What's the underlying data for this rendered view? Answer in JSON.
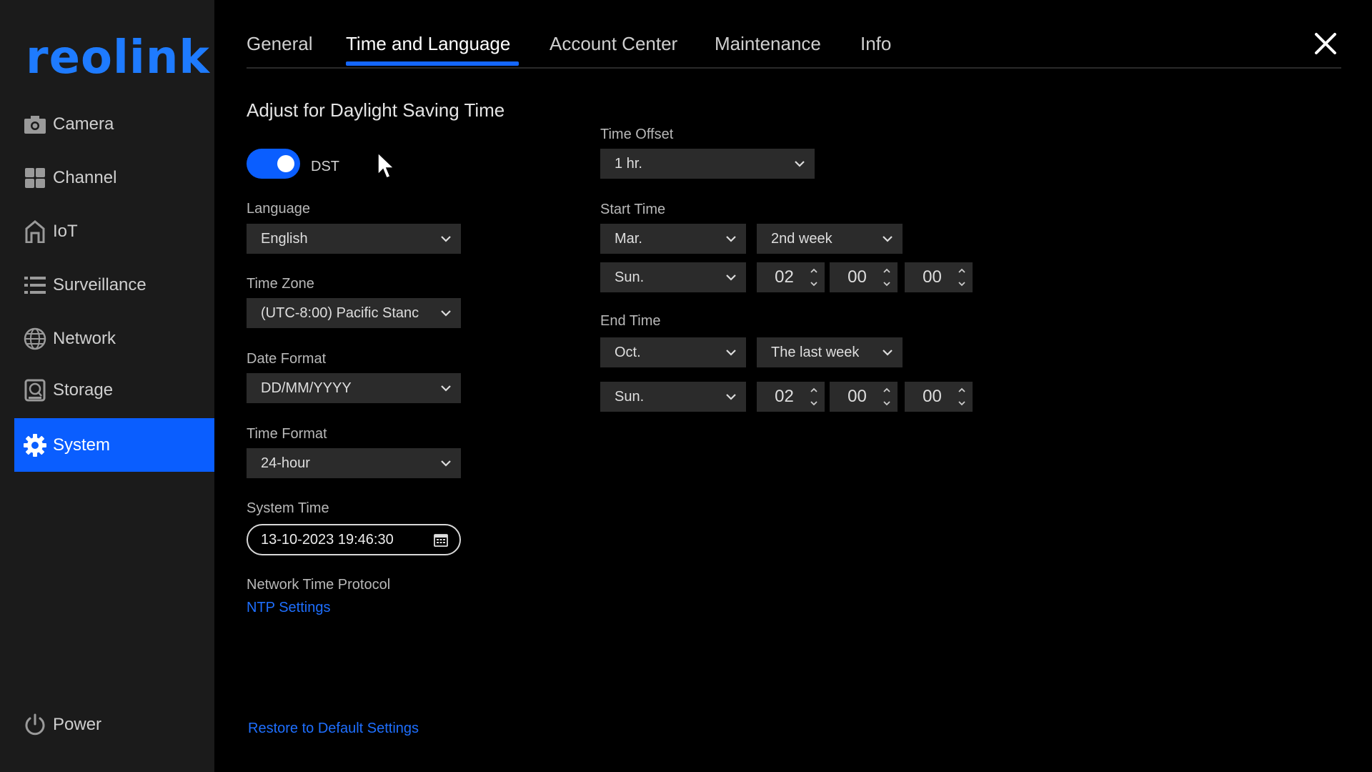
{
  "brand": {
    "logo_text": "reolink",
    "accent": "#0a5eff"
  },
  "sidebar": {
    "items": [
      {
        "label": "Camera",
        "icon": "camera-icon"
      },
      {
        "label": "Channel",
        "icon": "grid-icon"
      },
      {
        "label": "IoT",
        "icon": "home-icon"
      },
      {
        "label": "Surveillance",
        "icon": "list-icon"
      },
      {
        "label": "Network",
        "icon": "globe-icon"
      },
      {
        "label": "Storage",
        "icon": "storage-icon"
      },
      {
        "label": "System",
        "icon": "gear-icon",
        "active": true
      }
    ],
    "power": {
      "label": "Power",
      "icon": "power-icon"
    }
  },
  "tabs": [
    {
      "label": "General"
    },
    {
      "label": "Time and Language",
      "active": true
    },
    {
      "label": "Account Center"
    },
    {
      "label": "Maintenance"
    },
    {
      "label": "Info"
    }
  ],
  "dst": {
    "section_title": "Adjust for Daylight Saving Time",
    "toggle_label": "DST",
    "enabled": true
  },
  "language": {
    "label": "Language",
    "value": "English"
  },
  "time_zone": {
    "label": "Time Zone",
    "value": "(UTC-8:00) Pacific Stanc"
  },
  "date_format": {
    "label": "Date Format",
    "value": "DD/MM/YYYY"
  },
  "time_format": {
    "label": "Time Format",
    "value": "24-hour"
  },
  "system_time": {
    "label": "System Time",
    "value": "13-10-2023 19:46:30"
  },
  "ntp": {
    "label": "Network Time Protocol",
    "link": "NTP Settings"
  },
  "time_offset": {
    "label": "Time Offset",
    "value": "1 hr."
  },
  "start_time": {
    "label": "Start Time",
    "month": "Mar.",
    "week": "2nd week",
    "day": "Sun.",
    "hour": "02",
    "minute": "00",
    "second": "00"
  },
  "end_time": {
    "label": "End Time",
    "month": "Oct.",
    "week": "The last week",
    "day": "Sun.",
    "hour": "02",
    "minute": "00",
    "second": "00"
  },
  "restore_link": "Restore to Default Settings"
}
